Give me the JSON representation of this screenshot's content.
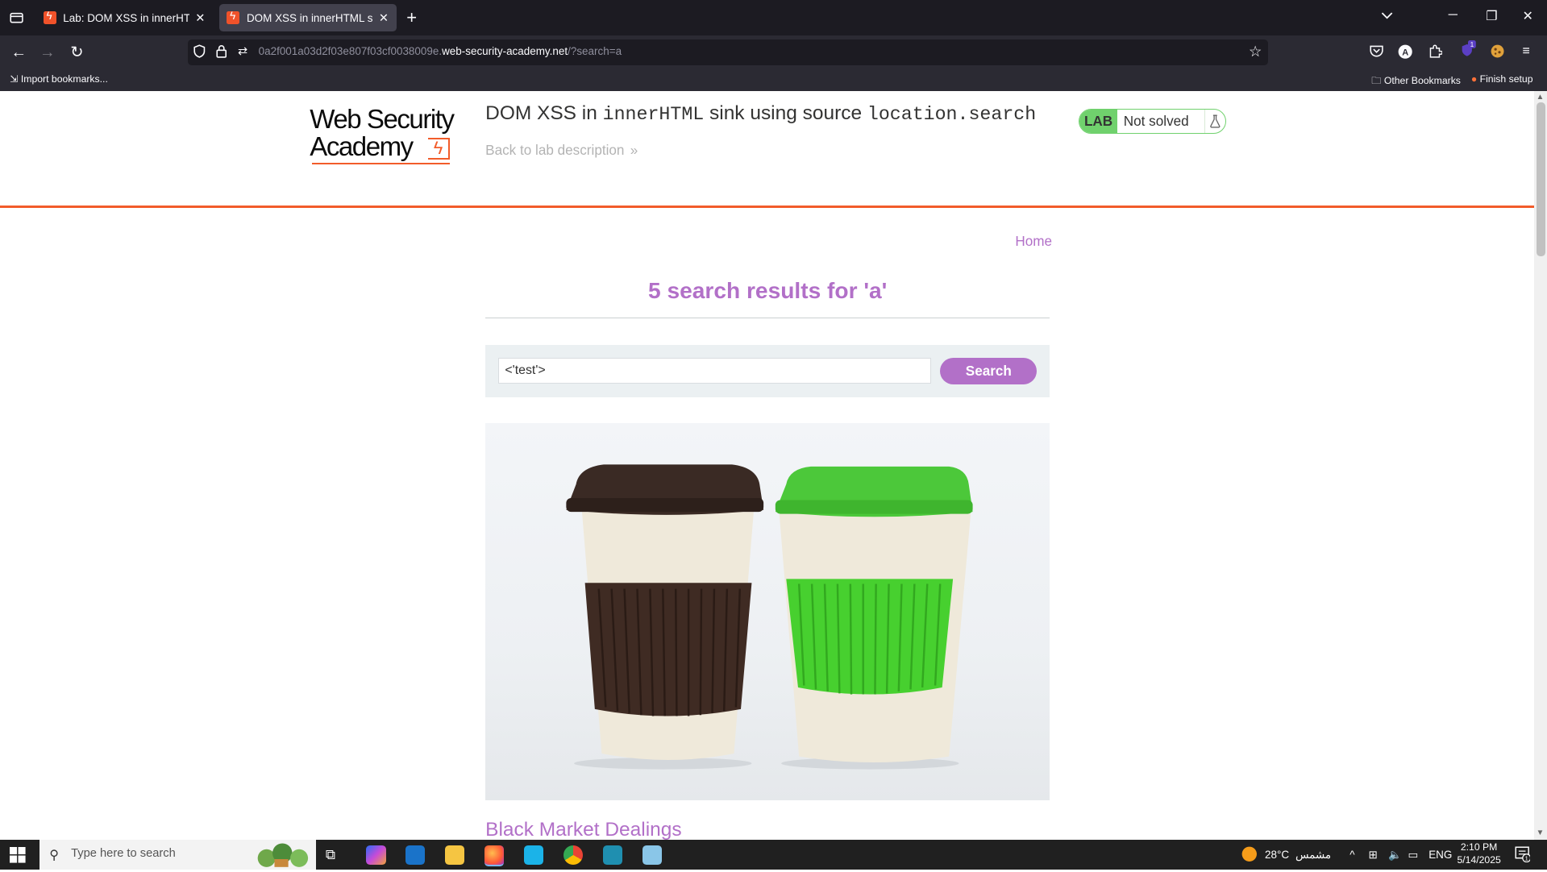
{
  "browser": {
    "tabs": [
      {
        "title": "Lab: DOM XSS in innerHTML sink using source location.search",
        "active": false
      },
      {
        "title": "DOM XSS in innerHTML sink using source location.search",
        "active": true
      }
    ],
    "url_prefix": "0a2f001a03d2f03e807f03cf0038009e.",
    "url_domain": "web-security-academy.net",
    "url_path": "/?search=a",
    "bookmarks": {
      "import": "Import bookmarks...",
      "other": "Other Bookmarks",
      "finish": "Finish setup"
    },
    "extension_badge": "1"
  },
  "header": {
    "logo_line1": "Web Security",
    "logo_line2": "Academy",
    "title_prefix": "DOM XSS in ",
    "title_code1": "innerHTML",
    "title_middle": " sink using source ",
    "title_code2": "location.search",
    "back_link": "Back to lab description",
    "lab_badge": "LAB",
    "lab_status": "Not solved"
  },
  "nav": {
    "home": "Home"
  },
  "search": {
    "heading": "5 search results for 'a'",
    "input_value": "<'test'>",
    "button": "Search"
  },
  "post": {
    "title": "Black Market Dealings"
  },
  "taskbar": {
    "search_placeholder": "Type here to search",
    "temperature": "28°C",
    "weather": "مشمس",
    "language": "ENG",
    "time": "2:10 PM",
    "date": "5/14/2025",
    "notifications": "1"
  },
  "colors": {
    "accent_purple": "#b270c8",
    "brand_orange": "#f25c2a",
    "lab_green": "#70d16d"
  }
}
